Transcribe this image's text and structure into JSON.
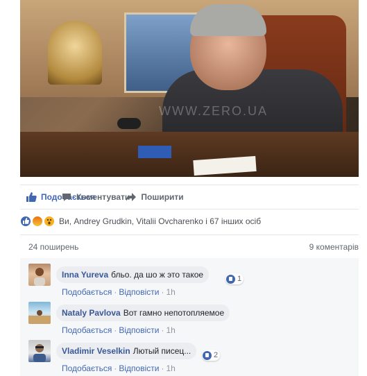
{
  "post": {
    "photo_watermark": "WWW.ZERO.UA",
    "actions": {
      "like": "Подобається",
      "comment": "Коментувати",
      "share": "Поширити"
    },
    "reactions_summary": "Ви, Andrey Grudkin, Vitalii Ovcharenko і 67 інших осіб",
    "shares_count": "24 поширень",
    "comments_count": "9 коментарів"
  },
  "colors": {
    "accent": "#4267b2",
    "author": "#385898",
    "muted": "#606770"
  },
  "comments": [
    {
      "author": "Inna Yureva",
      "text": "бльо. да шо ж это такое",
      "like_label": "Подобається",
      "reply_label": "Відповісти",
      "time": "1h",
      "reaction_count": "1"
    },
    {
      "author": "Nataly Pavlova",
      "text": "Вот гамно непотопляемое",
      "like_label": "Подобається",
      "reply_label": "Відповісти",
      "time": "1h",
      "reaction_count": ""
    },
    {
      "author": "Vladimir Veselkin",
      "text": "Лютый писец...",
      "like_label": "Подобається",
      "reply_label": "Відповісти",
      "time": "1h",
      "reaction_count": "2"
    }
  ],
  "icons": {
    "like_action": "thumbs-up-icon",
    "comment_action": "speech-bubble-icon",
    "share_action": "share-arrow-icon",
    "reaction_like": "like-reaction-icon",
    "reaction_angry": "angry-reaction-icon",
    "reaction_wow": "wow-reaction-icon"
  }
}
